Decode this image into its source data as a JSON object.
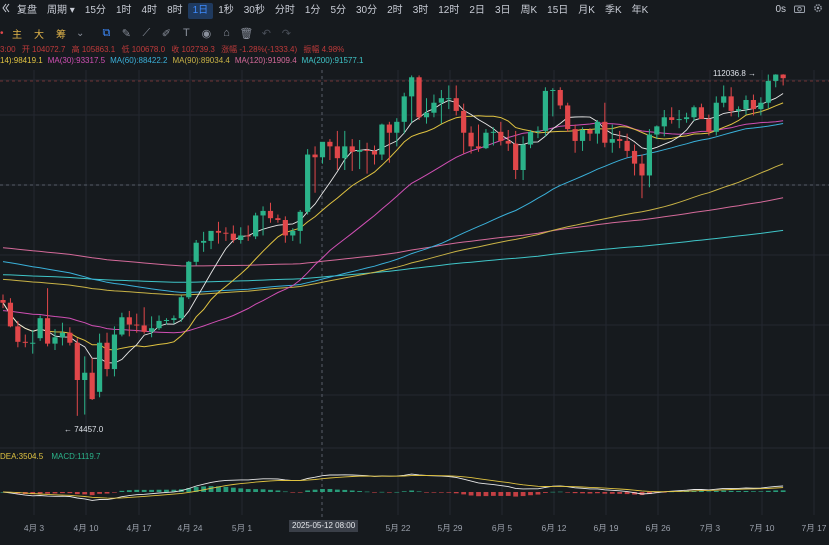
{
  "toolbar": {
    "back_icon": "double-chevron-left-icon",
    "replay_label": "复盘",
    "period_label": "周期",
    "timeframes": [
      "15分",
      "1时",
      "4时",
      "8时",
      "1日",
      "1秒",
      "30秒",
      "分时",
      "1分",
      "5分",
      "30分",
      "2时",
      "3时",
      "12时",
      "2日",
      "3日",
      "周K",
      "15日",
      "月K",
      "季K",
      "年K"
    ],
    "active_timeframe": "1日",
    "zoom_label": "0s",
    "right_icons": [
      "camera-icon",
      "gear-icon"
    ]
  },
  "tools": {
    "indicators": [
      "主",
      "大",
      "筹"
    ],
    "icons": [
      "line-tool-icon",
      "pencil-icon",
      "ruler-icon",
      "brush-icon",
      "text-icon",
      "eye-icon",
      "lock-icon",
      "trash-icon",
      "undo-icon",
      "redo-icon"
    ]
  },
  "ohlc": {
    "time": "3:00",
    "open": "开 104072.7",
    "high": "高 105863.1",
    "low": "低 100678.0",
    "close": "收 102739.3",
    "change": "涨幅 -1.28%(-1333.4)",
    "amplitude": "振幅 4.98%"
  },
  "ma_legend": [
    {
      "label": "14):98419.1",
      "color": "#e0c341"
    },
    {
      "label": "MA(30):93317.5",
      "color": "#d04fb4"
    },
    {
      "label": "MA(60):88422.2",
      "color": "#3ab0d9"
    },
    {
      "label": "MA(90):89034.4",
      "color": "#c9b346"
    },
    {
      "label": "MA(120):91909.4",
      "color": "#d46a9a"
    },
    {
      "label": "MA(200):91577.1",
      "color": "#3fc5c8"
    }
  ],
  "macd_legend": {
    "dea": "DEA:3504.5",
    "macd": "MACD:1119.7",
    "dea_color": "#e0c341",
    "macd_color": "#2bb38a"
  },
  "annotations": {
    "high_label": "112036.8",
    "low_label": "74457.0",
    "crosshair_date": "2025-05-12 08:00"
  },
  "xaxis_labels": [
    "4月 3",
    "4月 10",
    "4月 17",
    "4月 24",
    "5月 1",
    "5月 22",
    "5月 29",
    "6月 5",
    "6月 12",
    "6月 19",
    "6月 26",
    "7月 3",
    "7月 10",
    "7月 17"
  ],
  "colors": {
    "up": "#2bb38a",
    "down": "#e0474a",
    "ma7": "#e0c341",
    "ma30": "#d04fb4",
    "ma60": "#3ab0d9",
    "ma90": "#c9b346",
    "ma120": "#d46a9a",
    "ma200": "#3fc5c8",
    "accent": "#3d8bfd"
  },
  "chart_data": {
    "type": "candlestick",
    "x": [
      "3/27",
      "3/28",
      "3/29",
      "3/30",
      "3/31",
      "4/1",
      "4/2",
      "4/3",
      "4/4",
      "4/5",
      "4/6",
      "4/7",
      "4/8",
      "4/9",
      "4/10",
      "4/11",
      "4/12",
      "4/13",
      "4/14",
      "4/15",
      "4/16",
      "4/17",
      "4/18",
      "4/19",
      "4/20",
      "4/21",
      "4/22",
      "4/23",
      "4/24",
      "4/25",
      "4/26",
      "4/27",
      "4/28",
      "4/29",
      "4/30",
      "5/1",
      "5/2",
      "5/3",
      "5/4",
      "5/5",
      "5/6",
      "5/7",
      "5/8",
      "5/9",
      "5/10",
      "5/11",
      "5/12",
      "5/13",
      "5/14",
      "5/15",
      "5/16",
      "5/17",
      "5/18",
      "5/19",
      "5/20",
      "5/21",
      "5/22",
      "5/23",
      "5/24",
      "5/25",
      "5/26",
      "5/27",
      "5/28",
      "5/29",
      "5/30",
      "5/31",
      "6/1",
      "6/2",
      "6/3",
      "6/4",
      "6/5",
      "6/6",
      "6/7",
      "6/8",
      "6/9",
      "6/10",
      "6/11",
      "6/12",
      "6/13",
      "6/14",
      "6/15",
      "6/16",
      "6/17",
      "6/18",
      "6/19",
      "6/20",
      "6/21",
      "6/22",
      "6/23",
      "6/24",
      "6/25",
      "6/26",
      "6/27",
      "6/28",
      "6/29",
      "6/30",
      "7/1",
      "7/2",
      "7/3",
      "7/4",
      "7/5",
      "7/6",
      "7/7",
      "7/8",
      "7/9",
      "7/10"
    ],
    "open": [
      87200,
      86900,
      84300,
      82600,
      82500,
      83000,
      85200,
      82400,
      83100,
      83600,
      82500,
      78400,
      79200,
      77100,
      82500,
      79600,
      83400,
      85300,
      84500,
      84400,
      83700,
      84100,
      84900,
      85000,
      85200,
      87500,
      91400,
      93500,
      93700,
      94800,
      94600,
      94500,
      93800,
      94300,
      94200,
      96500,
      97000,
      96200,
      96000,
      94300,
      94800,
      96900,
      103200,
      102900,
      104600,
      104100,
      102800,
      104100,
      103500,
      103700,
      103600,
      103200,
      106500,
      105600,
      106800,
      109600,
      111700,
      107300,
      107800,
      108900,
      109400,
      109400,
      108000,
      105600,
      104100,
      103900,
      105600,
      105700,
      104700,
      104400,
      101500,
      104300,
      105700,
      105800,
      110200,
      110300,
      108600,
      106000,
      104700,
      105900,
      105500,
      106800,
      104500,
      104900,
      104700,
      103600,
      102200,
      100900,
      105400,
      106300,
      107300,
      107000,
      107100,
      107300,
      108400,
      107100,
      105700,
      108900,
      109600,
      108000,
      108200,
      109200,
      108200,
      108900,
      111300,
      112000
    ],
    "high": [
      87800,
      87400,
      84900,
      83400,
      83900,
      85500,
      88500,
      84000,
      84700,
      84200,
      83000,
      81000,
      80800,
      83500,
      83600,
      84300,
      85800,
      86000,
      85700,
      86400,
      85400,
      85500,
      85200,
      85500,
      87700,
      91500,
      93800,
      94700,
      94600,
      95800,
      95200,
      95400,
      95200,
      95400,
      96800,
      97500,
      97900,
      96600,
      96400,
      95100,
      97100,
      103800,
      104100,
      104300,
      104900,
      105800,
      105800,
      104900,
      104800,
      104500,
      104200,
      106600,
      106800,
      107200,
      110000,
      111900,
      111900,
      109400,
      109800,
      110300,
      110800,
      110800,
      108800,
      106300,
      106500,
      106000,
      106200,
      106800,
      105900,
      105800,
      105200,
      105900,
      106300,
      110600,
      110500,
      110600,
      108900,
      106500,
      106200,
      106100,
      107000,
      108900,
      106500,
      105800,
      105500,
      104300,
      103200,
      106000,
      106400,
      108100,
      108400,
      108100,
      107800,
      108600,
      108800,
      107600,
      109600,
      110800,
      110600,
      108500,
      109700,
      109800,
      109500,
      112000,
      112036.8,
      112036.8
    ],
    "low": [
      86300,
      84200,
      82000,
      82000,
      81300,
      82700,
      82100,
      81700,
      82200,
      82200,
      74457,
      74600,
      76200,
      76500,
      78800,
      78800,
      83200,
      83200,
      83600,
      83500,
      83100,
      83900,
      84500,
      84600,
      84800,
      87300,
      91000,
      92500,
      92800,
      93400,
      93700,
      93500,
      93400,
      93700,
      93900,
      94300,
      95700,
      95700,
      93500,
      93700,
      93400,
      96600,
      99000,
      102200,
      102600,
      101500,
      101500,
      101400,
      101600,
      101100,
      102100,
      102600,
      102300,
      104100,
      105500,
      106700,
      107000,
      106600,
      107300,
      106600,
      108200,
      107500,
      103300,
      103300,
      103500,
      103800,
      104200,
      104200,
      103600,
      100500,
      100400,
      103900,
      105000,
      105200,
      107400,
      108200,
      105700,
      103400,
      103600,
      104700,
      104400,
      104000,
      103400,
      103900,
      102900,
      100900,
      98400,
      99600,
      104900,
      105200,
      106600,
      106100,
      106700,
      106900,
      107200,
      105300,
      105300,
      108400,
      107400,
      107300,
      107600,
      107500,
      107500,
      108300,
      110600,
      110800
    ],
    "close": [
      86900,
      84300,
      82600,
      82500,
      82500,
      85200,
      82400,
      83100,
      83600,
      82500,
      78400,
      79200,
      76300,
      82500,
      79600,
      83400,
      85300,
      84500,
      84400,
      83700,
      84100,
      84900,
      85000,
      85200,
      87500,
      91400,
      93500,
      93700,
      94800,
      94600,
      94500,
      93800,
      94300,
      94200,
      96500,
      97000,
      96200,
      96000,
      94300,
      94800,
      96900,
      103200,
      102900,
      104600,
      104100,
      102800,
      104100,
      103500,
      103700,
      103600,
      103200,
      106500,
      105600,
      106800,
      109600,
      111700,
      107300,
      107800,
      108900,
      109400,
      109400,
      108000,
      105600,
      104100,
      103900,
      105600,
      105700,
      104700,
      104400,
      101500,
      104300,
      105700,
      105800,
      110200,
      110300,
      108600,
      106000,
      104700,
      105900,
      105500,
      106800,
      104500,
      104900,
      104700,
      103600,
      102200,
      100900,
      105400,
      106300,
      107300,
      107000,
      107100,
      107300,
      108400,
      107100,
      105700,
      108900,
      109600,
      108000,
      108200,
      109200,
      108200,
      108900,
      111300,
      112000,
      111600
    ]
  }
}
